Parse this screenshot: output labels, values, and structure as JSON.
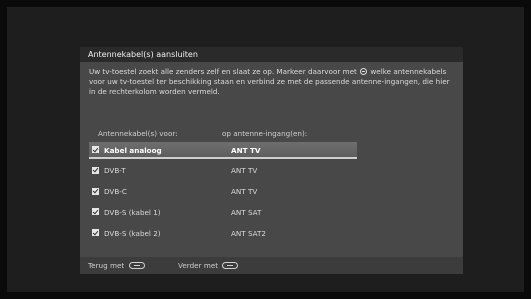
{
  "dialog": {
    "title": "Antennekabel(s) aansluiten",
    "description_part1": "Uw tv-toestel zoekt alle zenders zelf en slaat ze op. Markeer daarvoor met",
    "description_part2": "welke antennekabels voor uw tv-toestel ter beschikking staan en verbind ze met de passende antenne-ingangen, die hier in de rechterkolom worden vermeld.",
    "column_cable": "Antennekabel(s) voor:",
    "column_input": "op antenne-ingang(en):",
    "rows": [
      {
        "name": "Kabel analoog",
        "input": "ANT TV",
        "checked": true,
        "selected": true
      },
      {
        "name": "DVB-T",
        "input": "ANT TV",
        "checked": true,
        "selected": false
      },
      {
        "name": "DVB-C",
        "input": "ANT TV",
        "checked": true,
        "selected": false
      },
      {
        "name": "DVB-S (kabel 1)",
        "input": "ANT SAT",
        "checked": true,
        "selected": false
      },
      {
        "name": "DVB-S (kabel 2)",
        "input": "ANT SAT2",
        "checked": true,
        "selected": false
      }
    ],
    "footer": {
      "back_label": "Terug met",
      "next_label": "Verder met"
    }
  },
  "icons": {
    "ok_button": "ok-circle-icon",
    "remote_button": "remote-pill-icon",
    "checkbox": "checkbox-checked-icon"
  }
}
